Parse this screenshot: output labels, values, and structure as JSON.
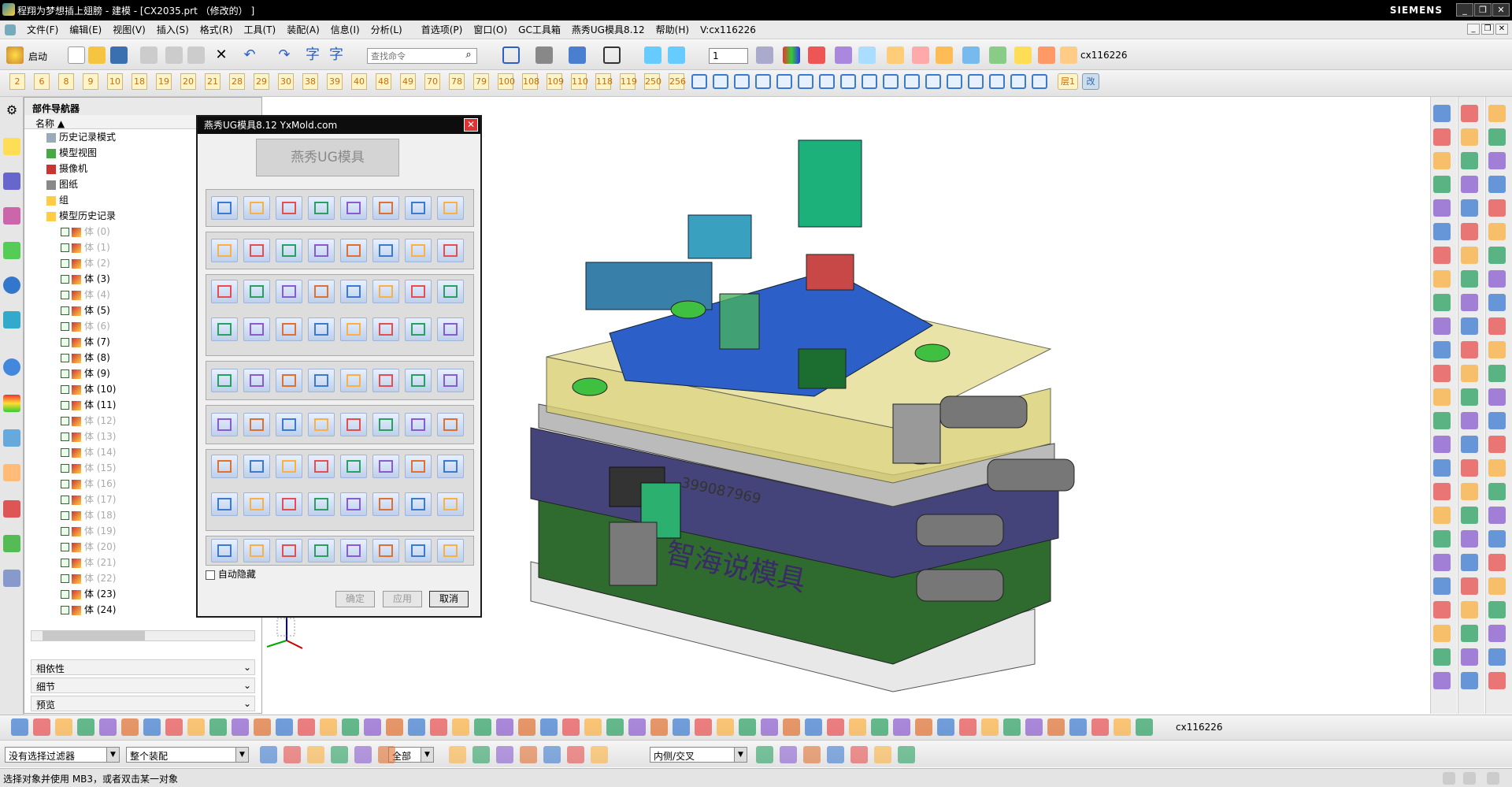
{
  "window": {
    "title": "程翔为梦想插上翅膀 - 建模 - [CX2035.prt （修改的） ]",
    "brand": "SIEMENS"
  },
  "menu": [
    "文件(F)",
    "编辑(E)",
    "视图(V)",
    "插入(S)",
    "格式(R)",
    "工具(T)",
    "装配(A)",
    "信息(I)",
    "分析(L)",
    "首选项(P)",
    "窗口(O)",
    "GC工具箱",
    "燕秀UG模具8.12",
    "帮助(H)",
    "V:cx116226"
  ],
  "toolbar": {
    "start_label": "启动",
    "search_placeholder": "查找命令",
    "layer_value": "1",
    "user_label": "cx116226",
    "numbers": [
      "2",
      "6",
      "8",
      "9",
      "10",
      "18",
      "19",
      "20",
      "21",
      "28",
      "29",
      "30",
      "38",
      "39",
      "40",
      "48",
      "49",
      "70",
      "78",
      "79",
      "100",
      "108",
      "109",
      "110",
      "118",
      "119",
      "250",
      "256"
    ],
    "layer_btn": "层1",
    "change_btn": "改"
  },
  "navigator": {
    "title": "部件导航器",
    "col_name": "名称",
    "items": [
      {
        "label": "历史记录模式",
        "dim": false
      },
      {
        "label": "模型视图",
        "dim": false
      },
      {
        "label": "摄像机",
        "dim": false
      },
      {
        "label": "图纸",
        "dim": false
      },
      {
        "label": "组",
        "dim": false
      },
      {
        "label": "模型历史记录",
        "dim": false
      }
    ],
    "bodies": [
      {
        "label": "体 (0)",
        "dim": true
      },
      {
        "label": "体 (1)",
        "dim": true
      },
      {
        "label": "体 (2)",
        "dim": true
      },
      {
        "label": "体 (3)",
        "dim": false
      },
      {
        "label": "体 (4)",
        "dim": true
      },
      {
        "label": "体 (5)",
        "dim": false
      },
      {
        "label": "体 (6)",
        "dim": true
      },
      {
        "label": "体 (7)",
        "dim": false
      },
      {
        "label": "体 (8)",
        "dim": false
      },
      {
        "label": "体 (9)",
        "dim": false
      },
      {
        "label": "体 (10)",
        "dim": false
      },
      {
        "label": "体 (11)",
        "dim": false
      },
      {
        "label": "体 (12)",
        "dim": true
      },
      {
        "label": "体 (13)",
        "dim": true
      },
      {
        "label": "体 (14)",
        "dim": true
      },
      {
        "label": "体 (15)",
        "dim": true
      },
      {
        "label": "体 (16)",
        "dim": true
      },
      {
        "label": "体 (17)",
        "dim": true
      },
      {
        "label": "体 (18)",
        "dim": true
      },
      {
        "label": "体 (19)",
        "dim": true
      },
      {
        "label": "体 (20)",
        "dim": true
      },
      {
        "label": "体 (21)",
        "dim": true
      },
      {
        "label": "体 (22)",
        "dim": true
      },
      {
        "label": "体 (23)",
        "dim": false
      },
      {
        "label": "体 (24)",
        "dim": false
      }
    ],
    "sections": [
      "相依性",
      "细节",
      "预览"
    ]
  },
  "dialog": {
    "title": "燕秀UG模具8.12   YxMold.com",
    "banner": "燕秀UG模具",
    "autohide_label": "自动隐藏",
    "ok_label": "确定",
    "apply_label": "应用",
    "cancel_label": "取消"
  },
  "model": {
    "engraving_number": "399087969",
    "engraving_text": "智海说模具"
  },
  "bottom_toolbar": {
    "user_label": "cx116226"
  },
  "selection_bar": {
    "filter": "没有选择过滤器",
    "scope": "整个装配",
    "all": "全部",
    "inside": "内侧/交叉"
  },
  "status": "选择对象并使用 MB3，或者双击某一对象",
  "colors": {
    "title_bg": "#000000",
    "toolbar_bg": "#ececec",
    "dialog_header": "#0d0d0d",
    "accent": "#2c60c8"
  }
}
